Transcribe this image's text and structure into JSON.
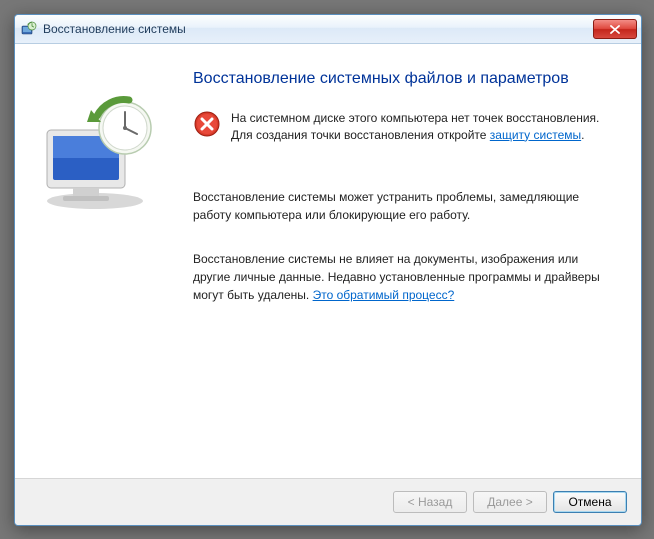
{
  "window": {
    "title": "Восстановление системы"
  },
  "heading": "Восстановление системных файлов и параметров",
  "error": {
    "pre": "На системном диске этого компьютера нет точек восстановления. Для создания точки восстановления откройте ",
    "link": "защиту системы",
    "post": "."
  },
  "para1": "Восстановление системы может устранить проблемы, замедляющие работу компьютера или блокирующие его работу.",
  "para2": {
    "text": "Восстановление системы не влияет на документы, изображения или другие личные данные. Недавно установленные программы и драйверы могут быть удалены. ",
    "link": "Это обратимый процесс?"
  },
  "buttons": {
    "back": "< Назад",
    "next": "Далее >",
    "cancel": "Отмена"
  }
}
